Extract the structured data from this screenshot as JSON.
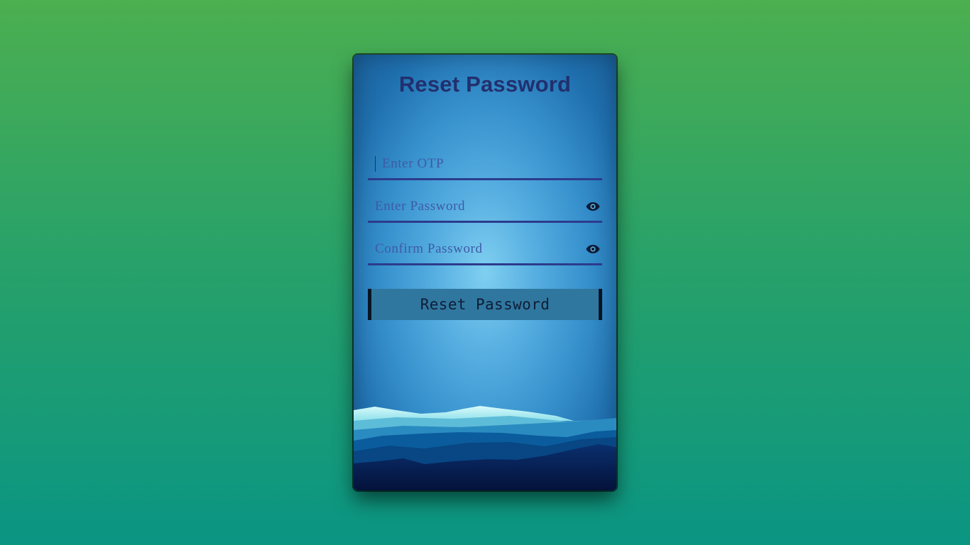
{
  "card": {
    "title": "Reset Password"
  },
  "form": {
    "otp_placeholder": "Enter OTP",
    "password_placeholder": "Enter Password",
    "confirm_placeholder": "Confirm Password",
    "submit_label": "Reset Password"
  },
  "icons": {
    "password_toggle": "eye-icon",
    "confirm_toggle": "eye-icon"
  },
  "colors": {
    "title": "#22306e",
    "input_underline": "#2c3b8c",
    "button_bg": "#30779f",
    "button_edges": "#051524"
  }
}
